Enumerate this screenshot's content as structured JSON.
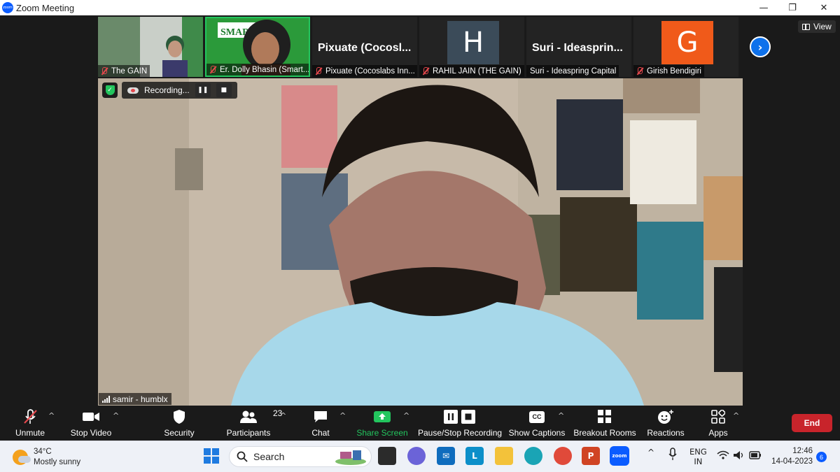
{
  "window": {
    "title": "Zoom Meeting",
    "logo_text": "zoom",
    "minimize": "—",
    "restore": "❐",
    "close": "✕"
  },
  "gallery": {
    "view_label": "View",
    "next_icon": "chevron-right",
    "tiles": [
      {
        "name": "The GAIN",
        "muted": true,
        "type": "video"
      },
      {
        "name": "Er. Dolly Bhasin (Smart...",
        "muted": true,
        "type": "video",
        "sign_text": "SMAR"
      },
      {
        "name": "Pixuate (Cocoslabs Inn...",
        "big_label": "Pixuate  (Cocosl...",
        "muted": true,
        "type": "name"
      },
      {
        "name": "RAHIL JAIN (THE GAIN)",
        "initial": "H",
        "avatar_color": "#3b4b59",
        "muted": true,
        "type": "avatar"
      },
      {
        "name": "Suri - Ideaspring Capital",
        "big_label": "Suri  -  Ideasprin...",
        "muted": false,
        "type": "name"
      },
      {
        "name": "Girish Bendigiri",
        "initial": "G",
        "avatar_color": "#f05a1a",
        "muted": true,
        "type": "avatar"
      }
    ]
  },
  "active_speaker": {
    "name": "samir - humblx",
    "recording_label": "Recording...",
    "pause_icon": "pause",
    "stop_icon": "stop",
    "shield_glyph": "✓"
  },
  "toolbar": {
    "unmute": "Unmute",
    "stop_video": "Stop Video",
    "security": "Security",
    "participants": "Participants",
    "participants_count": "23",
    "chat": "Chat",
    "share_screen": "Share Screen",
    "pause_stop_recording": "Pause/Stop Recording",
    "show_captions": "Show Captions",
    "captions_glyph": "CC",
    "breakout_rooms": "Breakout Rooms",
    "reactions": "Reactions",
    "apps": "Apps",
    "end": "End",
    "caret": "^"
  },
  "taskbar": {
    "temperature": "34°C",
    "weather": "Mostly sunny",
    "search_placeholder": "Search",
    "language_line1": "ENG",
    "language_line2": "IN",
    "time": "12:46",
    "date": "14-04-2023",
    "notifications": "6",
    "app_icons": [
      "windows-start",
      "widgets-art",
      "task-view",
      "teams-chat",
      "mail",
      "lexicon-l",
      "file-explorer",
      "edge",
      "chrome",
      "powerpoint",
      "zoom"
    ],
    "colors": {
      "accent": "#0b5cff",
      "end": "#c8242b",
      "green": "#23c55e"
    }
  }
}
